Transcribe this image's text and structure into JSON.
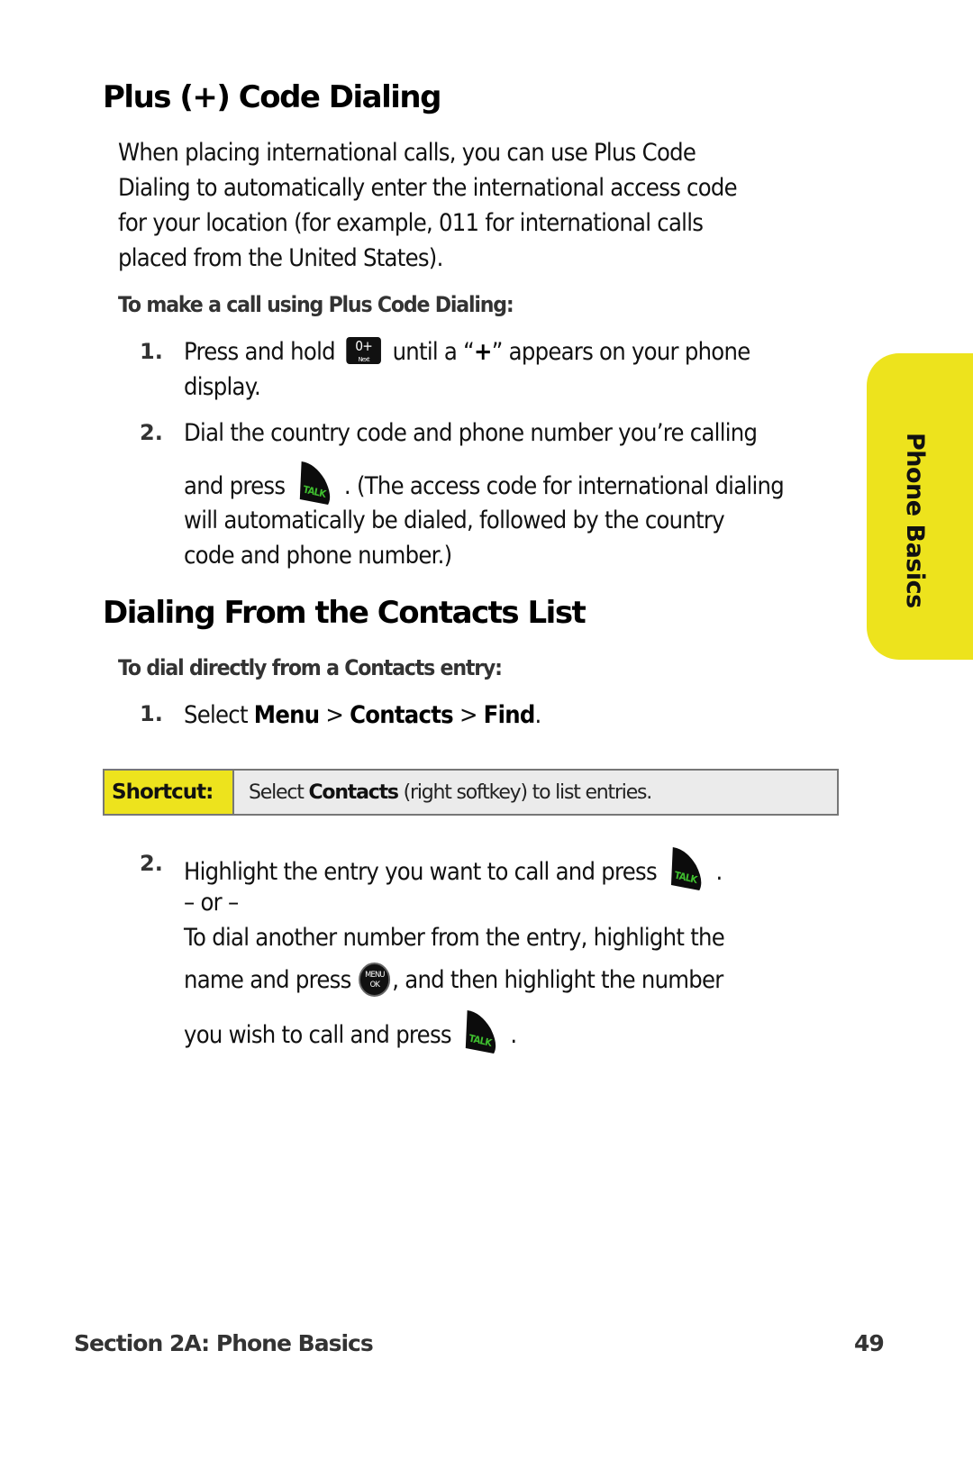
{
  "section1": {
    "title": "Plus (+) Code Dialing",
    "intro": [
      "When placing international calls, you can use Plus Code",
      "Dialing to automatically enter the international access code",
      "for your location (for example, 011 for international calls",
      "placed from the United States)."
    ],
    "subheading": "To make a call using Plus Code Dialing:",
    "steps": [
      {
        "number": "1.",
        "line1_before": "Press and hold",
        "key_icon": "zero-plus-next-key",
        "key_top": "0+",
        "key_bottom": "Next",
        "line1_after_pre": "until a “",
        "line1_after_bold": "+",
        "line1_after_post": "” appears on your phone",
        "line2": "display."
      },
      {
        "number": "2.",
        "line1": "Dial the country code and phone number you’re calling",
        "line2_before": "and press",
        "key_icon": "talk-key",
        "line2_after": ". (The access code for international dialing",
        "line3": "will automatically be dialed, followed by the country",
        "line4": "code and phone number.)"
      }
    ]
  },
  "section2": {
    "title": "Dialing From the Contacts List",
    "subheading": "To dial directly from a Contacts entry:",
    "step1": {
      "number": "1.",
      "prefix": "Select ",
      "path": [
        "Menu",
        "Contacts",
        "Find"
      ],
      "separator": " > ",
      "suffix": "."
    },
    "shortcut": {
      "label": "Shortcut:",
      "text_before": "Select ",
      "text_bold": "Contacts",
      "text_after": " (right softkey) to list entries."
    },
    "step2": {
      "number": "2.",
      "line1": "Highlight the entry you want to call and press",
      "line1_after": ".",
      "or": "– or –",
      "line3": "To dial another number from the entry, highlight the",
      "line4_before": "name and press",
      "menu_key_top": "MENU",
      "menu_key_bottom": "OK",
      "line4_after": ", and then highlight the number",
      "line5_before": "you wish to call and press",
      "line5_after": "."
    }
  },
  "talk_key_label": "TALK",
  "side_tab": {
    "label": "Phone Basics",
    "color": "#ede31d"
  },
  "footer": {
    "section": "Section 2A: Phone Basics",
    "page": "49"
  },
  "colors": {
    "accent_yellow": "#ede31d",
    "talk_green": "#3fbf2f",
    "shortcut_bg": "#ebebeb"
  }
}
